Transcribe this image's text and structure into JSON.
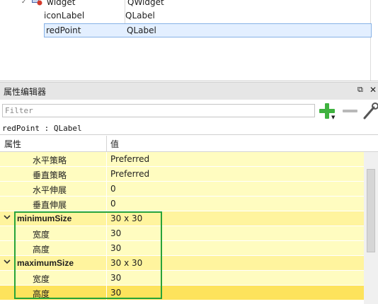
{
  "object_tree": {
    "rows": [
      {
        "name": "widget",
        "class": "QWidget"
      },
      {
        "name": "iconLabel",
        "class": "QLabel"
      },
      {
        "name": "redPoint",
        "class": "QLabel",
        "selected": true
      }
    ]
  },
  "property_editor": {
    "title": "属性编辑器",
    "float_icon": "float-icon",
    "close_icon": "close-icon",
    "filter_placeholder": "Filter",
    "add_icon": "plus-icon",
    "remove_icon": "minus-icon",
    "config_icon": "wrench-icon",
    "class_label": "redPoint : QLabel",
    "header": {
      "property": "属性",
      "value": "值"
    },
    "rows": [
      {
        "name": "水平策略",
        "value": "Preferred",
        "kind": "sub"
      },
      {
        "name": "垂直策略",
        "value": "Preferred",
        "kind": "sub"
      },
      {
        "name": "水平伸展",
        "value": "0",
        "kind": "sub"
      },
      {
        "name": "垂直伸展",
        "value": "0",
        "kind": "sub"
      },
      {
        "name": "minimumSize",
        "value": "30 x 30",
        "kind": "group",
        "expanded": true
      },
      {
        "name": "宽度",
        "value": "30",
        "kind": "sub"
      },
      {
        "name": "高度",
        "value": "30",
        "kind": "sub"
      },
      {
        "name": "maximumSize",
        "value": "30 x 30",
        "kind": "group",
        "expanded": true
      },
      {
        "name": "宽度",
        "value": "30",
        "kind": "sub"
      },
      {
        "name": "高度",
        "value": "30",
        "kind": "sub"
      }
    ]
  },
  "colors": {
    "group_row": "#fff49e",
    "sub_row": "#fffcc0",
    "selection": "#e3efff",
    "highlight_box": "#27a33a"
  }
}
